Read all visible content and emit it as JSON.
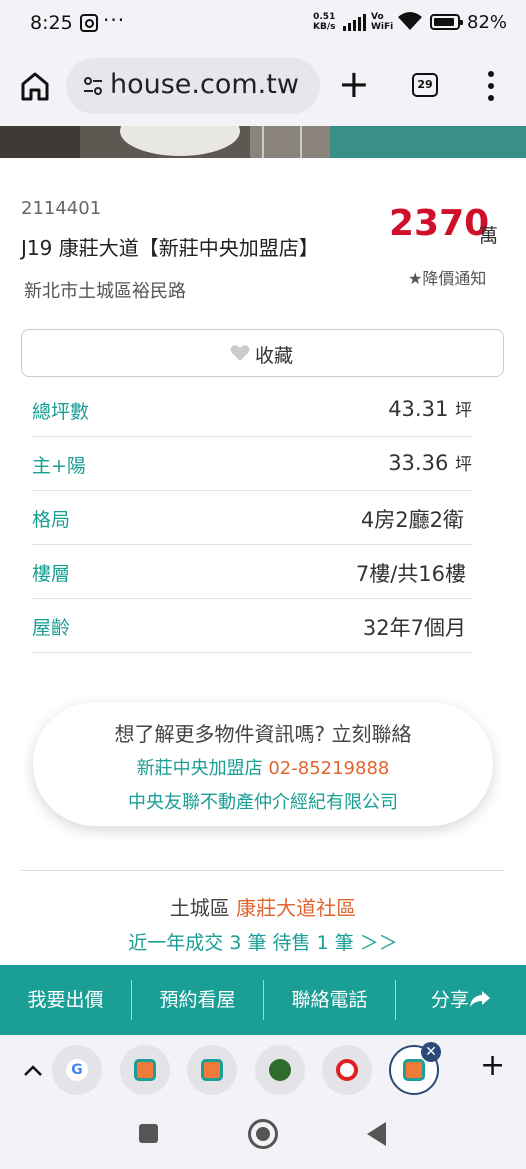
{
  "status": {
    "time": "8:25",
    "more": "···",
    "speed_value": "0.51",
    "speed_unit": "KB/s",
    "vowifi_top": "Vo",
    "vowifi_bottom": "WiFi",
    "battery": "82%"
  },
  "browser": {
    "url": "house.com.tw",
    "tab_count": "29",
    "new_tab": "+"
  },
  "listing": {
    "id": "2114401",
    "title": "J19 康莊大道【新莊中央加盟店】",
    "address": "新北市土城區裕民路",
    "price": "2370",
    "price_unit": "萬",
    "price_alert": "★降價通知",
    "favorite_label": "收藏"
  },
  "specs": [
    {
      "label": "總坪數",
      "value": "43.31",
      "unit": "坪"
    },
    {
      "label": "主+陽",
      "value": "33.36",
      "unit": "坪"
    },
    {
      "label": "格局",
      "value": "4房2廳2衛",
      "unit": ""
    },
    {
      "label": "樓層",
      "value": "7樓/共16樓",
      "unit": ""
    },
    {
      "label": "屋齡",
      "value": "32年7個月",
      "unit": ""
    }
  ],
  "contact": {
    "prompt": "想了解更多物件資訊嗎? 立刻聯絡",
    "branch": "新莊中央加盟店",
    "phone": "02-85219888",
    "company": "中央友聯不動產仲介經紀有限公司"
  },
  "community": {
    "district": "土城區",
    "name": "康莊大道社區",
    "transactions": "近一年成交 3 筆 待售 1 筆 ＞＞"
  },
  "actions": [
    {
      "label": "我要出價"
    },
    {
      "label": "預約看屋"
    },
    {
      "label": "聯絡電話"
    },
    {
      "label": "分享"
    }
  ],
  "colors": {
    "accent": "#1a9e95",
    "price": "#d0102a",
    "highlight": "#e0662f"
  }
}
